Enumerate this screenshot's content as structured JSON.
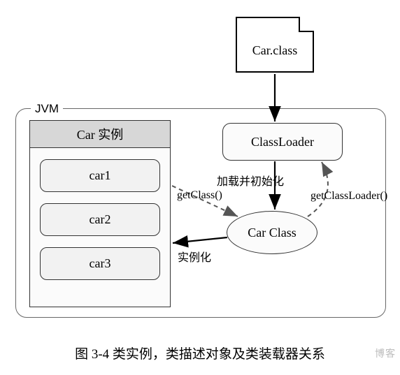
{
  "file": {
    "label": "Car.class"
  },
  "jvm": {
    "title": "JVM"
  },
  "instances": {
    "header": "Car 实例",
    "items": [
      "car1",
      "car2",
      "car3"
    ]
  },
  "classloader": {
    "label": "ClassLoader"
  },
  "classobj": {
    "label": "Car Class"
  },
  "edges": {
    "load_init": "加载并初始化",
    "getClass": "getClass()",
    "instantiate": "实例化",
    "getClassLoader": "getClassLoader()"
  },
  "caption": "图 3-4  类实例，类描述对象及类装载器关系",
  "watermark": "博客",
  "chart_data": {
    "type": "diagram",
    "nodes": [
      {
        "id": "file",
        "label": "Car.class",
        "shape": "file"
      },
      {
        "id": "jvm",
        "label": "JVM",
        "shape": "container"
      },
      {
        "id": "instances",
        "label": "Car 实例",
        "shape": "panel",
        "parent": "jvm",
        "children": [
          "car1",
          "car2",
          "car3"
        ]
      },
      {
        "id": "car1",
        "label": "car1",
        "shape": "rounded-rect",
        "parent": "instances"
      },
      {
        "id": "car2",
        "label": "car2",
        "shape": "rounded-rect",
        "parent": "instances"
      },
      {
        "id": "car3",
        "label": "car3",
        "shape": "rounded-rect",
        "parent": "instances"
      },
      {
        "id": "classloader",
        "label": "ClassLoader",
        "shape": "rounded-rect",
        "parent": "jvm"
      },
      {
        "id": "carclass",
        "label": "Car Class",
        "shape": "ellipse",
        "parent": "jvm"
      }
    ],
    "edges": [
      {
        "from": "file",
        "to": "classloader",
        "style": "solid",
        "label": ""
      },
      {
        "from": "classloader",
        "to": "carclass",
        "style": "solid",
        "label": "加载并初始化"
      },
      {
        "from": "carclass",
        "to": "instances",
        "style": "solid",
        "label": "实例化"
      },
      {
        "from": "instances",
        "to": "carclass",
        "style": "dashed",
        "label": "getClass()"
      },
      {
        "from": "carclass",
        "to": "classloader",
        "style": "dashed",
        "label": "getClassLoader()"
      }
    ],
    "title": "图 3-4  类实例，类描述对象及类装载器关系"
  }
}
